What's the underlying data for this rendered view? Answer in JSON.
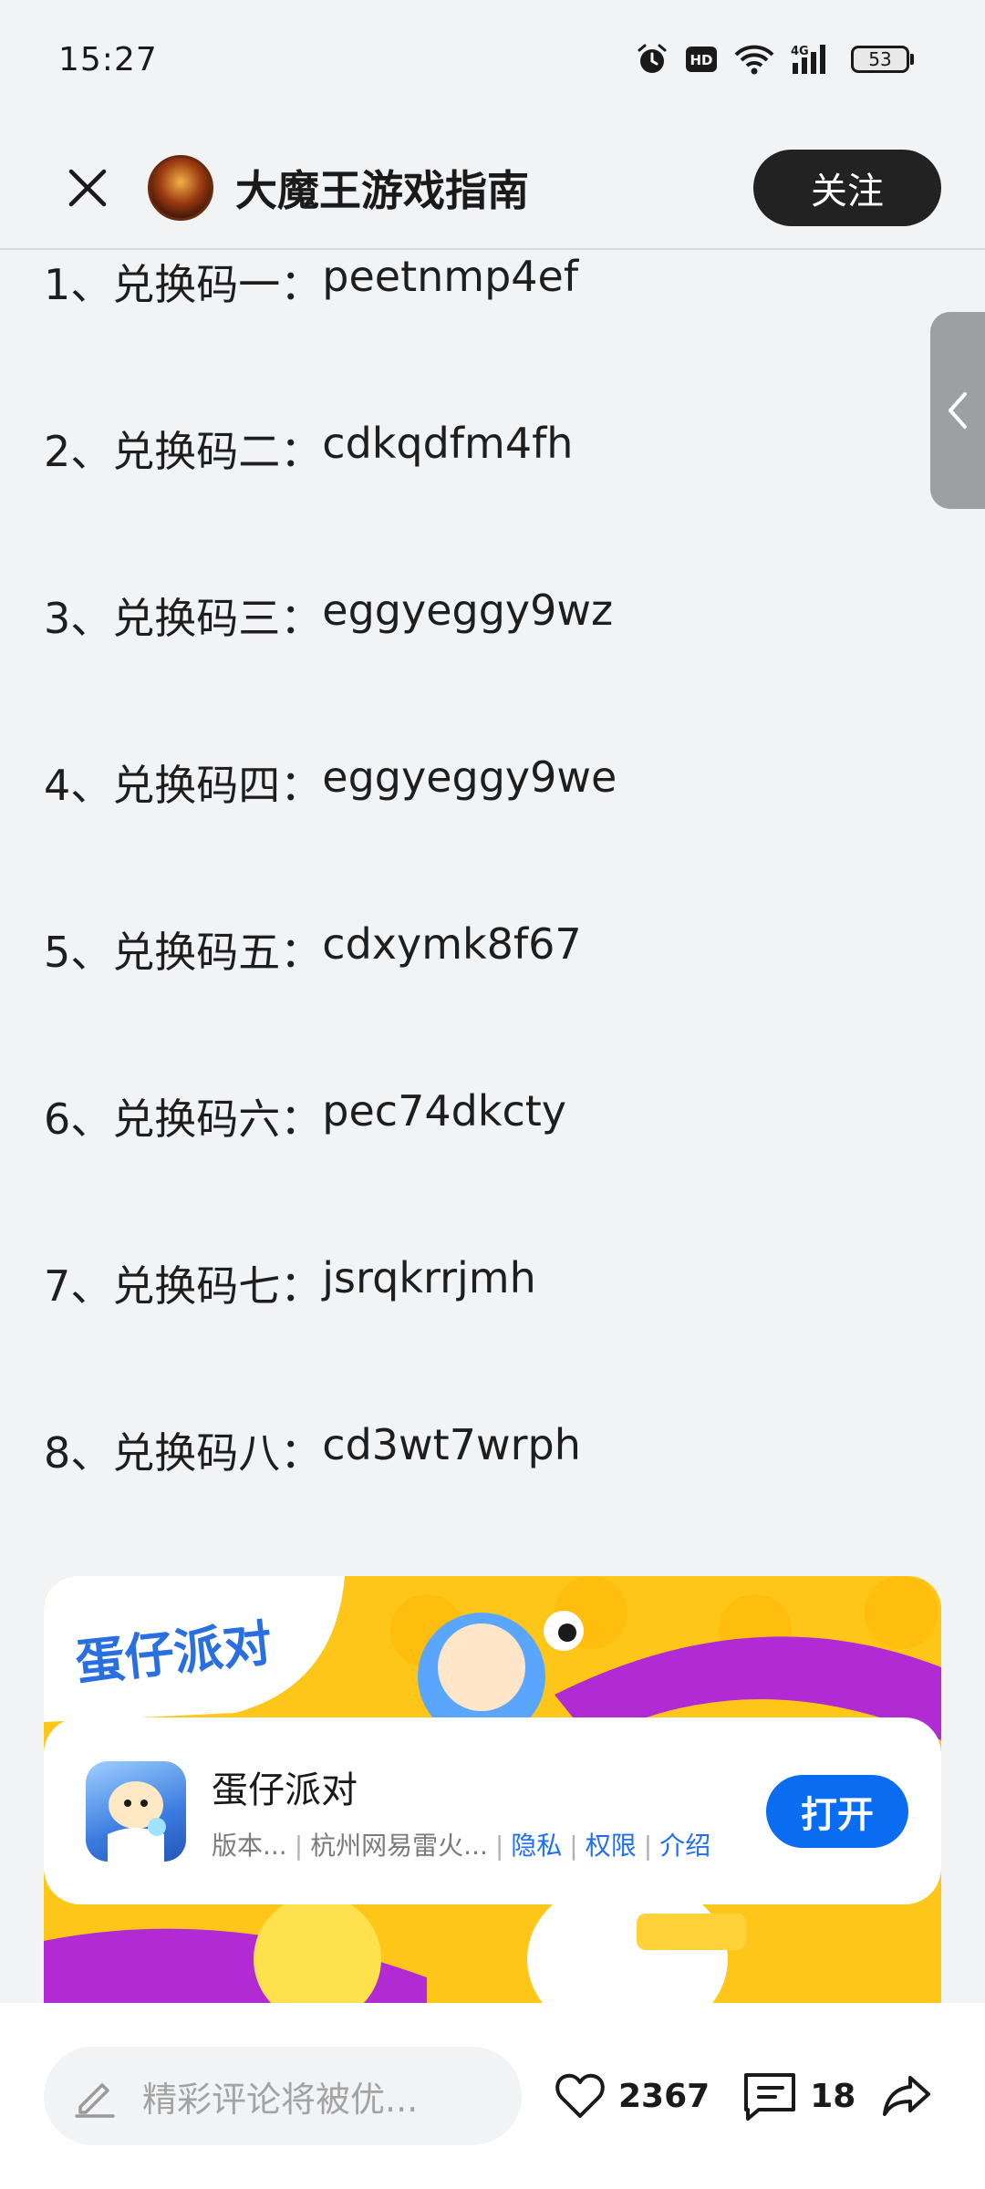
{
  "status_bar": {
    "time": "15:27",
    "icons": [
      "alarm-icon",
      "hd-icon",
      "wifi-icon",
      "4g-signal-icon",
      "battery-icon"
    ],
    "battery_level": "53"
  },
  "header": {
    "account_name": "大魔王游戏指南",
    "follow_label": "关注"
  },
  "codes": [
    {
      "label": "1、兑换码一：",
      "value": "peetnmp4ef"
    },
    {
      "label": "2、兑换码二：",
      "value": "cdkqdfm4fh"
    },
    {
      "label": "3、兑换码三：",
      "value": "eggyeggy9wz"
    },
    {
      "label": "4、兑换码四：",
      "value": "eggyeggy9we"
    },
    {
      "label": "5、兑换码五：",
      "value": "cdxymk8f67"
    },
    {
      "label": "6、兑换码六：",
      "value": "pec74dkcty"
    },
    {
      "label": "7、兑换码七：",
      "value": "jsrqkrrjmh"
    },
    {
      "label": "8、兑换码八：",
      "value": "cd3wt7wrph"
    }
  ],
  "ad": {
    "banner_logo": "蛋仔派对",
    "app_name": "蛋仔派对",
    "version": "版本...",
    "developer": "杭州网易雷火...",
    "links": [
      "隐私",
      "权限",
      "介绍"
    ],
    "open_label": "打开",
    "colors": {
      "banner": "#ffc61a",
      "accent": "#0a6cf0",
      "link": "#1f6ff2"
    }
  },
  "bottom_bar": {
    "comment_placeholder": "精彩评论将被优...",
    "likes": "2367",
    "comments": "18"
  }
}
